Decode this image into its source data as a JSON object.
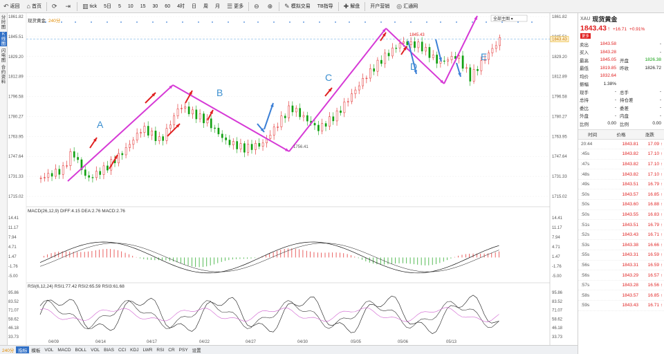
{
  "toolbar": {
    "items": [
      {
        "label": "返回",
        "icon": "back-icon"
      },
      {
        "label": "首页",
        "icon": "home-icon"
      },
      {
        "label": "",
        "icon": "refresh-icon"
      },
      {
        "label": "",
        "icon": "forward-icon"
      },
      {
        "label": "tick",
        "icon": "chart-icon"
      },
      {
        "label": "5日"
      },
      {
        "label": "5"
      },
      {
        "label": "10"
      },
      {
        "label": "15"
      },
      {
        "label": "30"
      },
      {
        "label": "60"
      },
      {
        "label": "4时"
      },
      {
        "label": "日"
      },
      {
        "label": "周"
      },
      {
        "label": "月"
      },
      {
        "label": "更多",
        "icon": "menu-icon"
      },
      {
        "label": "",
        "icon": "zoom-out-icon"
      },
      {
        "label": "",
        "icon": "zoom-in-icon"
      },
      {
        "label": "模拟交易",
        "icon": "trade-icon"
      },
      {
        "label": "TB指导"
      },
      {
        "label": "解盘",
        "icon": "analysis-icon"
      },
      {
        "label": "开户营销"
      },
      {
        "label": "汇通网",
        "icon": "site-icon"
      }
    ]
  },
  "leftnav": [
    "分时图",
    "K线图",
    "闪电图",
    "合约资料"
  ],
  "main_chart": {
    "title": "现货黄金",
    "period": "240分",
    "dropdown": "全部主图",
    "y_ticks": [
      "1861.82",
      "1845.51",
      "1829.20",
      "1812.89",
      "1796.58",
      "1780.27",
      "1763.95",
      "1747.64",
      "1731.33",
      "1715.02"
    ],
    "current_price_tag": "1843.43",
    "high_label": "1845.43",
    "low_label": "1756.41",
    "wave_labels": [
      "A",
      "B",
      "C",
      "D",
      "E"
    ],
    "x_dates": [
      "04/09",
      "04/14",
      "04/17",
      "04/22",
      "04/27",
      "04/30",
      "05/05",
      "05/06",
      "05/13"
    ]
  },
  "macd": {
    "header": "MACD(26,12,9) DIFF:4.15  DEA:2.76  MACD:2.76",
    "y_ticks": [
      "14.41",
      "11.17",
      "7.94",
      "4.71",
      "1.47",
      "-1.76",
      "-5.00"
    ]
  },
  "rsi": {
    "header": "RSI(6,12,24) RSI1:77.42  RSI2:65.59  RSI3:61.68",
    "y_ticks": [
      "95.86",
      "83.52",
      "71.07",
      "58.62",
      "46.18",
      "33.73"
    ]
  },
  "bottombar": [
    "240分",
    "指标",
    "模板",
    "VOL",
    "MACD",
    "BOLL",
    "VOL",
    "BIAS",
    "CCI",
    "KDJ",
    "LWR",
    "RSI",
    "CR",
    "PSY",
    "设置"
  ],
  "panel": {
    "code": "XAU",
    "name": "现货黄金",
    "price": "1843.43",
    "arrow": "↑",
    "change": "+16.71",
    "change_pct": "+0.91%",
    "tag": "更多",
    "quotes": [
      {
        "l": "卖出",
        "v": "1843.58",
        "l2": "",
        "v2": "-"
      },
      {
        "l": "买入",
        "v": "1843.28",
        "l2": "",
        "v2": "-"
      },
      {
        "l": "最高",
        "v": "1845.05",
        "l2": "开盘",
        "v2": "1826.38"
      },
      {
        "l": "最低",
        "v": "1819.85",
        "l2": "昨收",
        "v2": "1826.72"
      },
      {
        "l": "均价",
        "v": "1832.64",
        "l2": "",
        "v2": ""
      },
      {
        "l": "振幅",
        "v": "1.38%",
        "l2": "",
        "v2": ""
      },
      {
        "l": "现手",
        "v": "-",
        "l2": "总手",
        "v2": "-"
      },
      {
        "l": "总持",
        "v": "-",
        "l2": "持仓差",
        "v2": "-"
      },
      {
        "l": "委比",
        "v": "-",
        "l2": "委差",
        "v2": "-"
      },
      {
        "l": "外盘",
        "v": "-",
        "l2": "内盘",
        "v2": "-"
      },
      {
        "l": "比例",
        "v": "0.00",
        "l2": "比例",
        "v2": "0.00"
      }
    ],
    "tick_headers": [
      "时间",
      "价格",
      "涨跌"
    ],
    "ticks": [
      {
        "t": "20:44",
        "p": "1843.81",
        "c": "17.09 ↑"
      },
      {
        "t": ":45s",
        "p": "1843.82",
        "c": "17.10 ↑"
      },
      {
        "t": ":47s",
        "p": "1843.82",
        "c": "17.10 ↑"
      },
      {
        "t": ":48s",
        "p": "1843.82",
        "c": "17.10 ↑"
      },
      {
        "t": ":49s",
        "p": "1843.51",
        "c": "16.79 ↑"
      },
      {
        "t": ":50s",
        "p": "1843.57",
        "c": "16.85 ↑"
      },
      {
        "t": ":50s",
        "p": "1843.60",
        "c": "16.88 ↑"
      },
      {
        "t": ":50s",
        "p": "1843.55",
        "c": "16.83 ↑"
      },
      {
        "t": ":51s",
        "p": "1843.51",
        "c": "16.79 ↑"
      },
      {
        "t": ":52s",
        "p": "1843.43",
        "c": "16.71 ↑"
      },
      {
        "t": ":53s",
        "p": "1843.38",
        "c": "16.66 ↑"
      },
      {
        "t": ":55s",
        "p": "1843.31",
        "c": "16.59 ↑"
      },
      {
        "t": ":56s",
        "p": "1843.31",
        "c": "16.59 ↑"
      },
      {
        "t": ":56s",
        "p": "1843.29",
        "c": "16.57 ↑"
      },
      {
        "t": ":57s",
        "p": "1843.28",
        "c": "16.56 ↑"
      },
      {
        "t": ":58s",
        "p": "1843.57",
        "c": "16.85 ↑"
      },
      {
        "t": ":59s",
        "p": "1843.43",
        "c": "16.71 ↑"
      }
    ]
  },
  "colors": {
    "up": "#e02020",
    "down": "#11a011",
    "wave": "#d63ad6",
    "blue_arrow": "#3b7fd6",
    "accent": "#2f6fc6"
  }
}
